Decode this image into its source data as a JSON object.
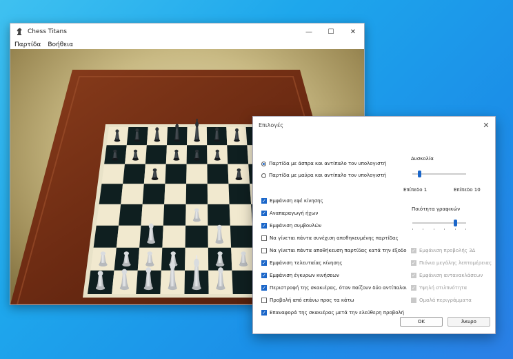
{
  "window": {
    "title": "Chess Titans",
    "menu": [
      "Παρτίδα",
      "Βοήθεια"
    ],
    "controls": {
      "minimize": "—",
      "maximize": "☐",
      "close": "✕"
    }
  },
  "dialog": {
    "title": "Επιλογές",
    "close": "✕",
    "game_mode": [
      {
        "label": "Παρτίδα με άσπρα και αντίπαλο τον υπολογιστή",
        "selected": true
      },
      {
        "label": "Παρτίδα με μαύρα και αντίπαλο τον υπολογιστή",
        "selected": false
      }
    ],
    "difficulty": {
      "label": "Δυσκολία",
      "min_label": "Επίπεδο 1",
      "max_label": "Επίπεδο 10",
      "level": 1
    },
    "graphics_quality": {
      "label": "Ποιότητα γραφικών",
      "level_fraction": 0.82
    },
    "options": [
      {
        "label": "Εμφάνιση εφέ κίνησης",
        "checked": true
      },
      {
        "label": "Αναπαραγωγή ήχων",
        "checked": true
      },
      {
        "label": "Εμφάνιση συμβουλών",
        "checked": true
      },
      {
        "label": "Να γίνεται πάντα συνέχιση αποθηκευμένης παρτίδας",
        "checked": false
      },
      {
        "label": "Να γίνεται πάντα αποθήκευση παρτίδας κατά την έξοδο",
        "checked": false
      },
      {
        "label": "Εμφάνιση τελευταίας κίνησης",
        "checked": true
      },
      {
        "label": "Εμφάνιση έγκυρων κινήσεων",
        "checked": true
      },
      {
        "label": "Περιστροφή της σκακιέρας, όταν παίζουν δύο αντίπαλοι",
        "checked": true
      },
      {
        "label": "Προβολή από επάνω προς τα κάτω",
        "checked": false
      },
      {
        "label": "Επαναφορά της σκακιέρας μετά την ελεύθερη προβολή",
        "checked": true
      }
    ],
    "graphics_options": [
      {
        "label": "Εμφάνιση προβολής 3Δ",
        "checked": true
      },
      {
        "label": "Πιόνια μεγάλης λεπτομέρειας",
        "checked": true
      },
      {
        "label": "Εμφάνιση αντανακλάσεων",
        "checked": true
      },
      {
        "label": "Υψηλή στιλπνότητα",
        "checked": true
      },
      {
        "label": "Ομαλά περιγράμματα",
        "checked": false
      }
    ],
    "ok_label": "OK",
    "cancel_label": "Άκυρο"
  },
  "colors": {
    "accent": "#1a66c9",
    "desktop": "#1ea7ec"
  }
}
